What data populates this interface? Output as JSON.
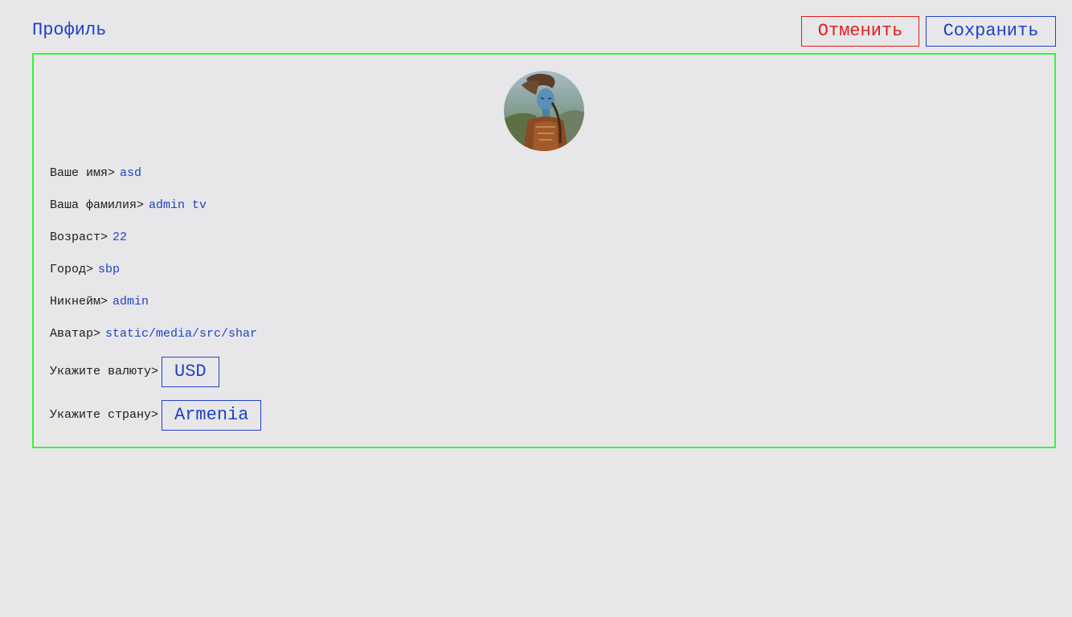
{
  "header": {
    "title": "Профиль",
    "cancel_label": "Отменить",
    "save_label": "Сохранить"
  },
  "profile": {
    "avatar_icon": "user-avatar-photo",
    "fields": {
      "first_name": {
        "label": "Ваше имя>",
        "value": "asd"
      },
      "last_name": {
        "label": "Ваша фамилия>",
        "value": "admin tv"
      },
      "age": {
        "label": "Возраст>",
        "value": "22"
      },
      "city": {
        "label": "Город>",
        "value": "sbp"
      },
      "nickname": {
        "label": "Никнейм>",
        "value": "admin"
      },
      "avatar": {
        "label": "Аватар>",
        "value": "static/media/src/shar"
      },
      "currency": {
        "label": "Укажите валюту>",
        "value": "USD"
      },
      "country": {
        "label": "Укажите страну>",
        "value": "Armenia"
      }
    }
  },
  "colors": {
    "background": "#e7e7ea",
    "accent": "#2142c2",
    "cancel": "#e21d1d",
    "card_border": "#3ff03a",
    "label_text": "#1c1c1c"
  }
}
